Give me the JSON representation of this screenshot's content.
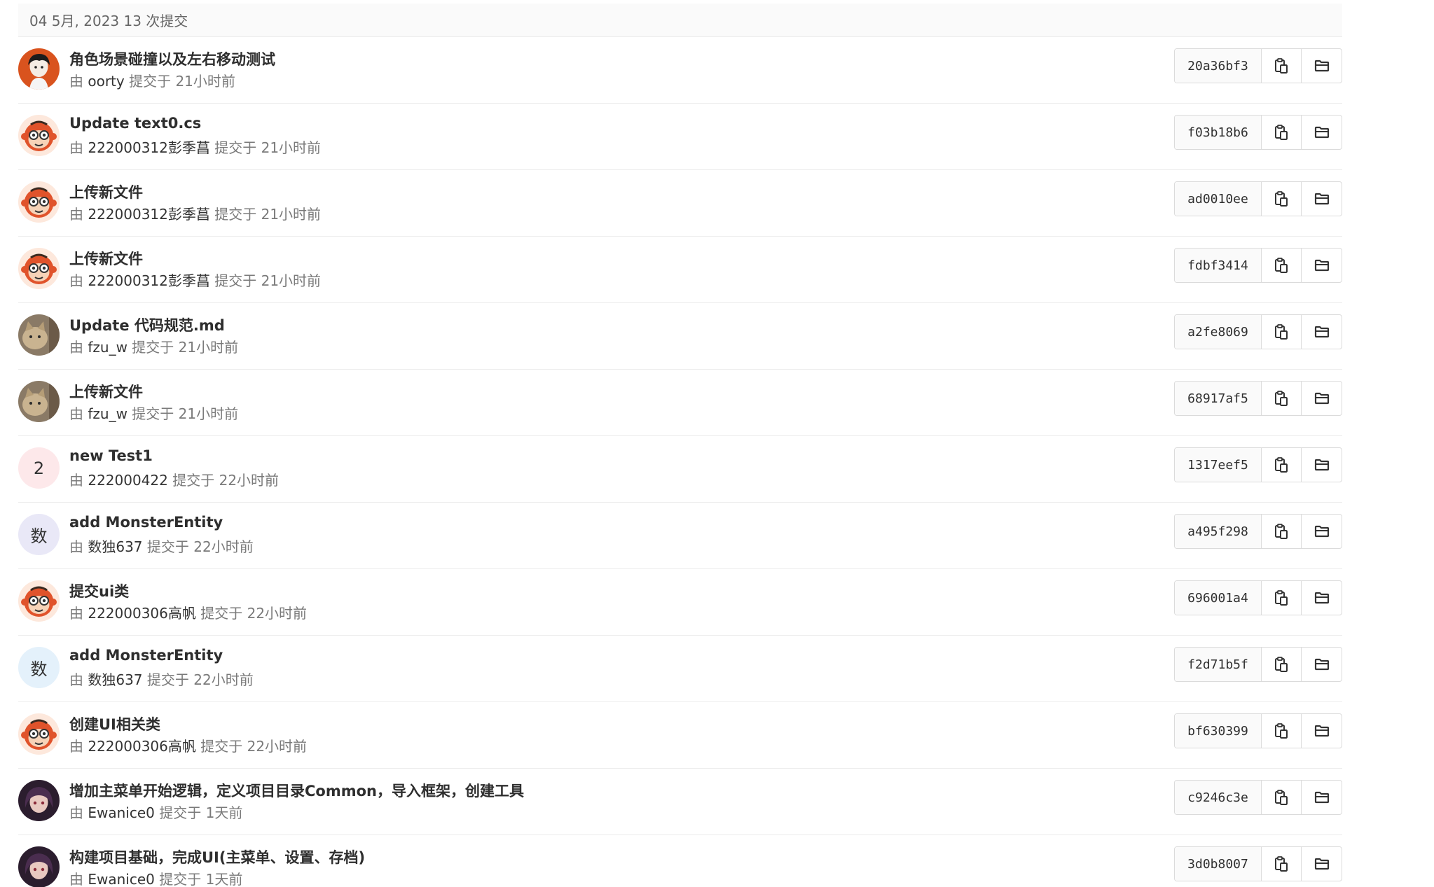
{
  "header": {
    "date_label": "04 5月, 2023 13 次提交"
  },
  "labels": {
    "by": "由 ",
    "committed": " 提交于 "
  },
  "colors": {
    "header_bg": "#fafafa",
    "border": "#dbdbdb",
    "monkey_bg": "#fde8dc",
    "monkey_face": "#e0532b",
    "anime_bg": "#d9531e",
    "cat_bg": "#8a7a66",
    "dark_avatar_bg": "#2b1d2e",
    "letter_bg_pink": "#fde8ea",
    "letter_bg_lavender": "#e9e8f7",
    "letter_bg_blue": "#e4f1fb"
  },
  "commits": [
    {
      "title": "角色场景碰撞以及左右移动测试",
      "author": "oorty",
      "time": "21小时前",
      "sha": "20a36bf3",
      "avatar": "anime-avatar"
    },
    {
      "title": "Update text0.cs",
      "author": "222000312彭季菖",
      "time": "21小时前",
      "sha": "f03b18b6",
      "avatar": "monkey-avatar"
    },
    {
      "title": "上传新文件",
      "author": "222000312彭季菖",
      "time": "21小时前",
      "sha": "ad0010ee",
      "avatar": "monkey-avatar"
    },
    {
      "title": "上传新文件",
      "author": "222000312彭季菖",
      "time": "21小时前",
      "sha": "fdbf3414",
      "avatar": "monkey-avatar"
    },
    {
      "title": "Update 代码规范.md",
      "author": "fzu_w",
      "time": "21小时前",
      "sha": "a2fe8069",
      "avatar": "cat-avatar"
    },
    {
      "title": "上传新文件",
      "author": "fzu_w",
      "time": "21小时前",
      "sha": "68917af5",
      "avatar": "cat-avatar"
    },
    {
      "title": "new Test1",
      "author": "222000422",
      "time": "22小时前",
      "sha": "1317eef5",
      "avatar": "letter-avatar",
      "avatar_letter": "2",
      "avatar_color": "#fde8ea"
    },
    {
      "title": "add MonsterEntity",
      "author": "数独637",
      "time": "22小时前",
      "sha": "a495f298",
      "avatar": "letter-avatar",
      "avatar_letter": "数",
      "avatar_color": "#e9e8f7"
    },
    {
      "title": "提交ui类",
      "author": "222000306高帆",
      "time": "22小时前",
      "sha": "696001a4",
      "avatar": "monkey-avatar"
    },
    {
      "title": "add MonsterEntity",
      "author": "数独637",
      "time": "22小时前",
      "sha": "f2d71b5f",
      "avatar": "letter-avatar",
      "avatar_letter": "数",
      "avatar_color": "#e4f1fb"
    },
    {
      "title": "创建UI相关类",
      "author": "222000306高帆",
      "time": "22小时前",
      "sha": "bf630399",
      "avatar": "monkey-avatar"
    },
    {
      "title": "增加主菜单开始逻辑，定义项目目录Common，导入框架，创建工具",
      "author": "Ewanice0",
      "time": "1天前",
      "sha": "c9246c3e",
      "avatar": "portrait-avatar"
    },
    {
      "title": "构建项目基础，完成UI(主菜单、设置、存档)",
      "author": "Ewanice0",
      "time": "1天前",
      "sha": "3d0b8007",
      "avatar": "portrait-avatar"
    }
  ],
  "icons": {
    "copy": "clipboard-icon",
    "browse": "folder-icon"
  }
}
